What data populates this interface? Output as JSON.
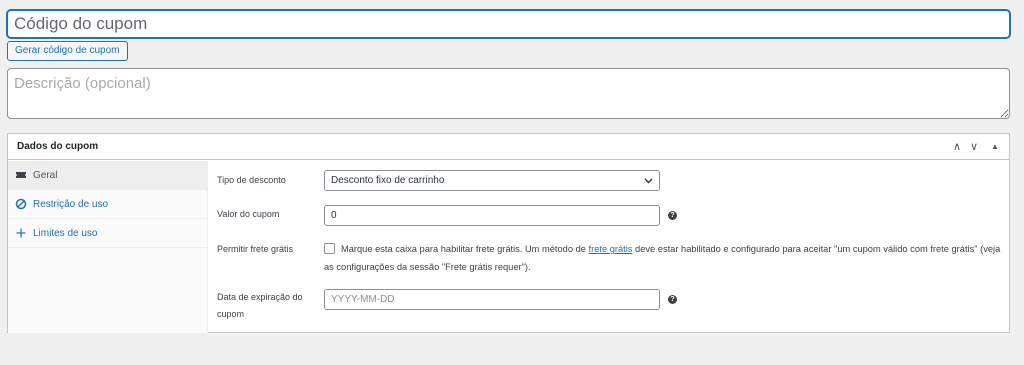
{
  "title_field": {
    "placeholder": "Código do cupom",
    "value": ""
  },
  "generate_button": {
    "label": "Gerar código de cupom"
  },
  "description_field": {
    "placeholder": "Descrição (opcional)",
    "value": ""
  },
  "panel": {
    "title": "Dados do cupom",
    "controls": {
      "up": "∧",
      "down": "∨",
      "toggle": "▲"
    },
    "tabs": [
      {
        "label": "Geral",
        "icon": "ticket-icon",
        "active": true
      },
      {
        "label": "Restrição de uso",
        "icon": "block-icon",
        "active": false
      },
      {
        "label": "Limites de uso",
        "icon": "plus-icon",
        "active": false
      }
    ],
    "fields": {
      "discount_type": {
        "label": "Tipo de desconto",
        "value": "Desconto fixo de carrinho"
      },
      "amount": {
        "label": "Valor do cupom",
        "value": "0"
      },
      "free_shipping": {
        "label": "Permitir frete grátis",
        "text_before": "Marque esta caixa para habilitar frete grátis. Um método de ",
        "link": "frete grátis",
        "text_after": " deve estar habilitado e configurado para aceitar \"um cupom válido com frete grátis\" (veja as configurações da sessão \"Frete grátis requer\").",
        "checked": false
      },
      "expiry_date": {
        "label": "Data de expiração do cupom",
        "placeholder": "YYYY-MM-DD",
        "value": ""
      }
    }
  }
}
